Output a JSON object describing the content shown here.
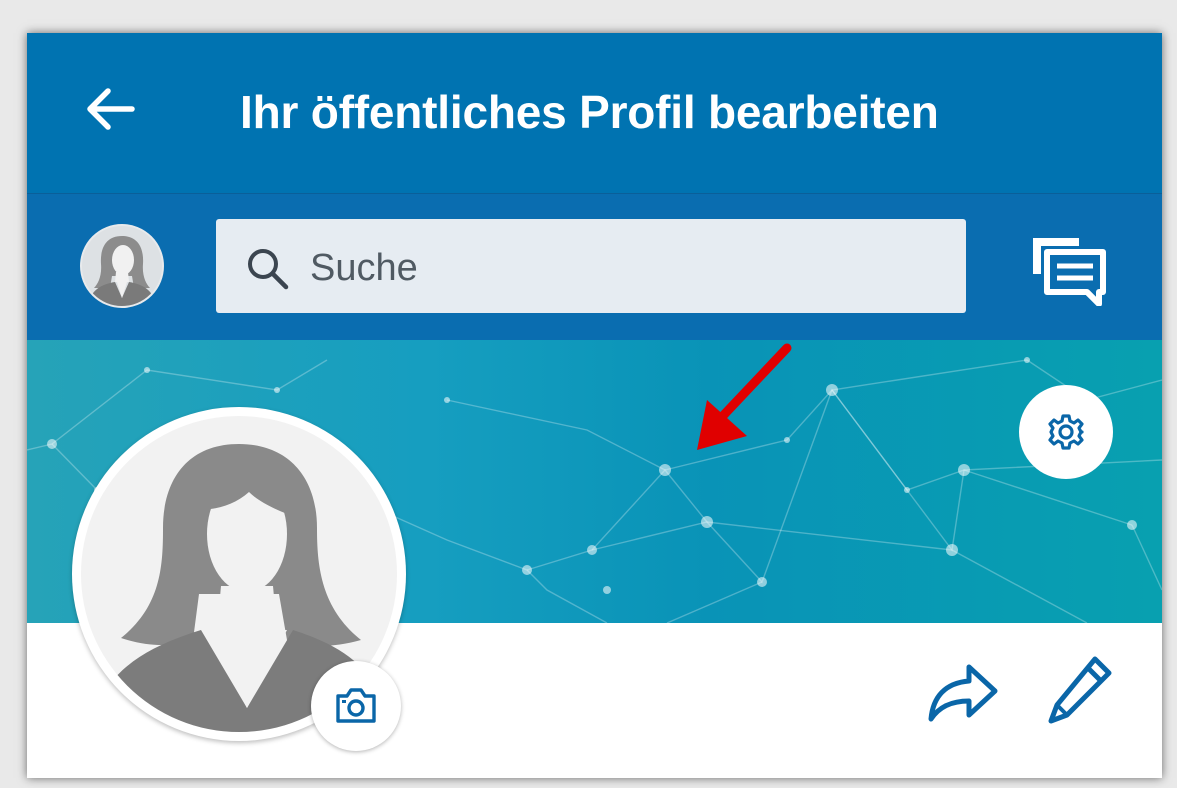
{
  "header": {
    "title": "Ihr öffentliches Profil bearbeiten",
    "back_icon": "arrow-left-icon"
  },
  "toolbar": {
    "avatar_icon": "profile-avatar-icon",
    "search": {
      "placeholder": "Suche",
      "value": "",
      "icon": "search-icon"
    },
    "messages_icon": "chat-bubbles-icon"
  },
  "banner": {
    "settings_icon": "gear-icon",
    "annotation": "red-arrow-icon"
  },
  "profile": {
    "photo_icon": "profile-placeholder-icon",
    "camera_icon": "camera-icon",
    "share_icon": "share-arrow-icon",
    "edit_icon": "pencil-icon"
  },
  "colors": {
    "brand": "#0073b1",
    "toolbar": "#0a6db0",
    "search_bg": "#e6ecf2",
    "banner_teal": "#0993b7",
    "annotation_red": "#e00000"
  }
}
